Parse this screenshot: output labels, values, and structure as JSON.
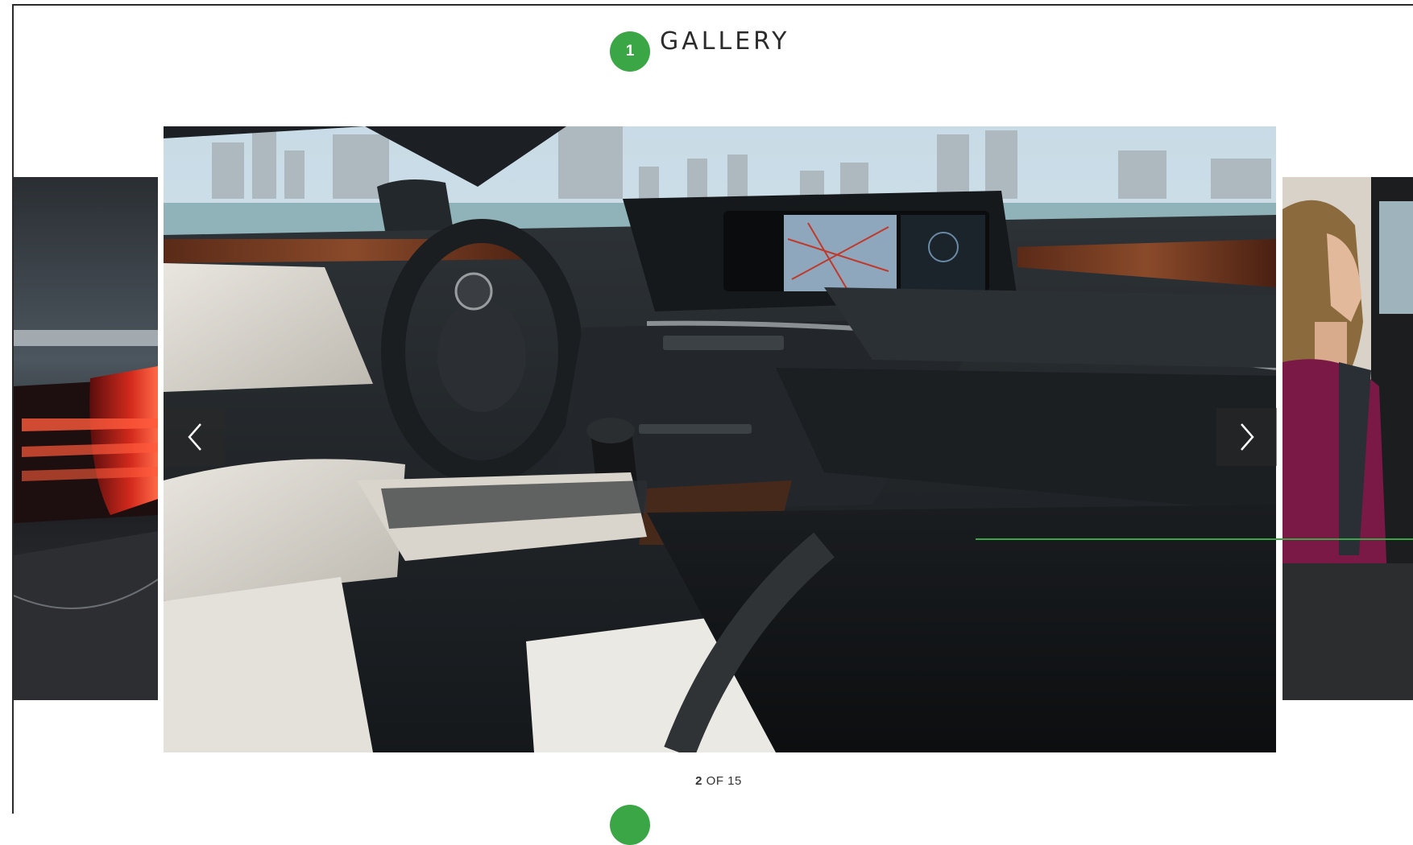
{
  "header": {
    "step": "1",
    "title": "GALLERY"
  },
  "pagination": {
    "current": "2",
    "separator": "OF",
    "total": "15"
  },
  "next_step": {
    "step": ""
  },
  "colors": {
    "accent": "#3aa645",
    "text": "#2b2b2b",
    "nav_bg": "#282828"
  },
  "icons": {
    "prev": "chevron-left-icon",
    "next": "chevron-right-icon"
  }
}
